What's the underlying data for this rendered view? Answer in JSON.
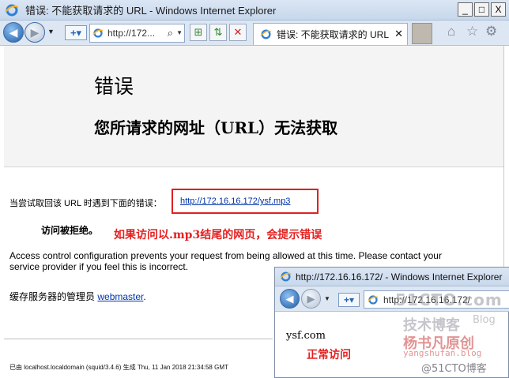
{
  "window": {
    "title": "错误: 不能获取请求的 URL - Windows Internet Explorer",
    "minimize": "_",
    "maximize": "□",
    "close": "X"
  },
  "toolbar": {
    "back_icon": "back-arrow-icon",
    "forward_icon": "forward-arrow-icon",
    "address": "http://172...",
    "search_glyph": "⌕",
    "tab_label": "错误: 不能获取请求的 URL",
    "tab_close": "✕"
  },
  "page": {
    "title": "错误",
    "subtitle": "您所请求的网址（URL）无法获取",
    "attempt_text": "当尝试取回该 URL 时遇到下面的错误：",
    "requested_url": "http://172.16.16.172/ysf.mp3",
    "denied": "访问被拒绝。",
    "annotation": "如果访问以.mp3结尾的网页，会提示错误",
    "access_text": "Access control configuration prevents your request from being allowed at this time. Please contact your service provider if you feel this is incorrect.",
    "admin_prefix": "缓存服务器的管理员",
    "admin_link": "webmaster",
    "admin_suffix": ".",
    "footer": "已由 localhost.localdomain (squid/3.4.6) 生成 Thu, 11 Jan 2018 21:34:58 GMT"
  },
  "overlay": {
    "title": "http://172.16.16.172/ - Windows Internet Explorer",
    "address": "http://172.16.16.172/",
    "site_text": "ysf.com",
    "annotation": "正常访问"
  },
  "watermark": {
    "line1": "51CTO.com",
    "line2": "技术博客",
    "line2b": "Blog",
    "line3": "杨书凡原创",
    "line4": "yangshufan.blog",
    "line5": "@51CTO博客"
  },
  "colors": {
    "accent_red": "#e52020",
    "link_blue": "#0033aa"
  }
}
